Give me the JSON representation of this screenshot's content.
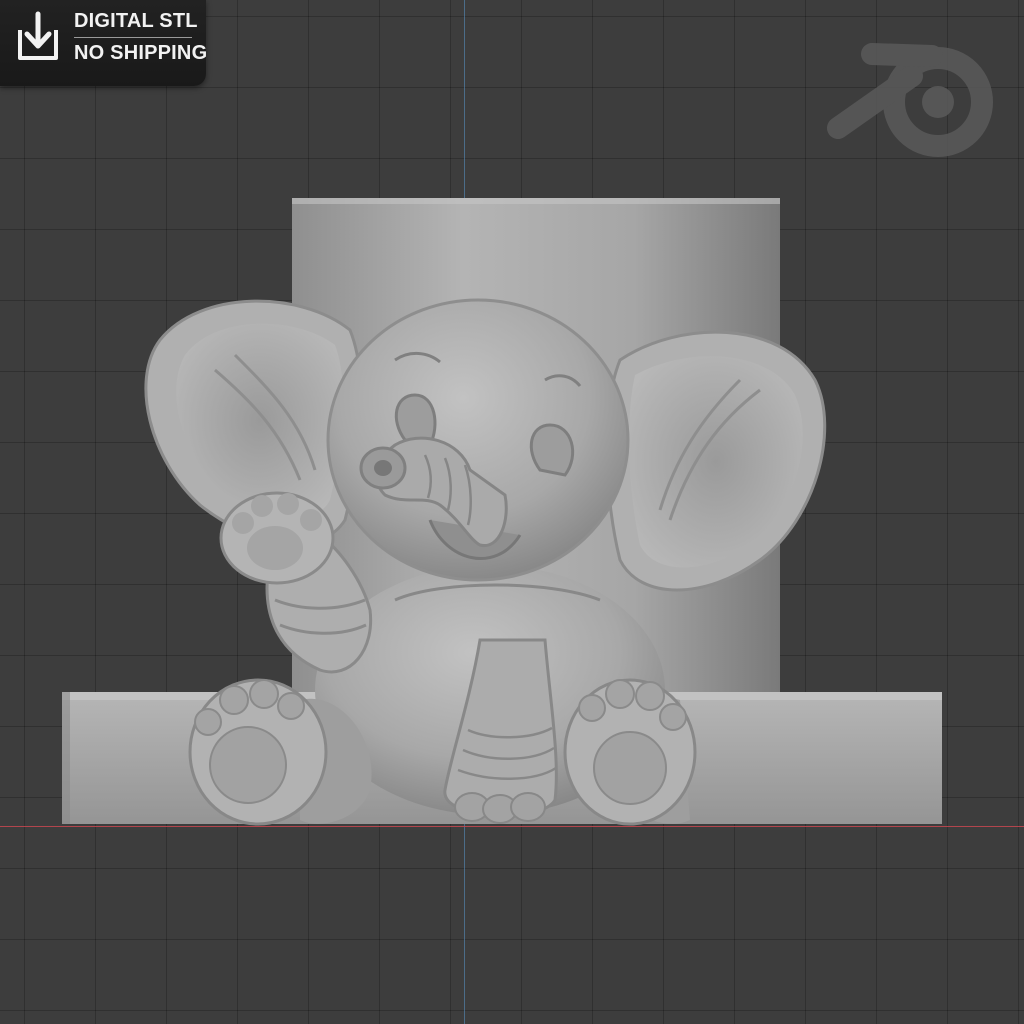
{
  "badge": {
    "line1": "DIGITAL STL",
    "line2": "NO SHIPPING",
    "icon": "download-icon"
  },
  "watermark": {
    "icon": "blender-logo-icon"
  },
  "scene": {
    "object": "elephant-planter-model",
    "background": "#3d3d3d",
    "model_color": "#a9a9a9"
  }
}
